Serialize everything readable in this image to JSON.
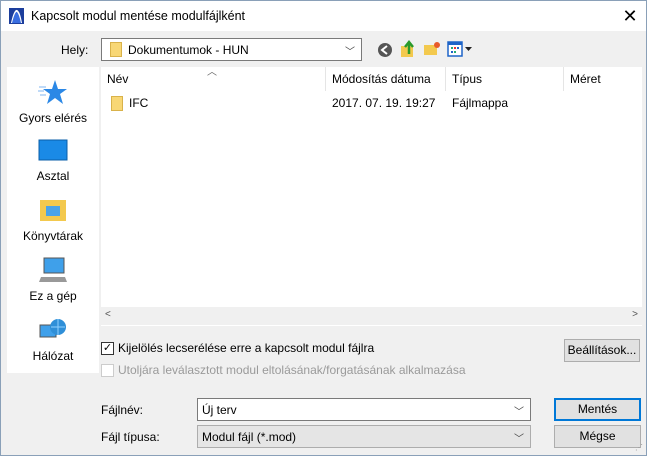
{
  "title": "Kapcsolt modul mentése modulfájlként",
  "location": {
    "label": "Hely:",
    "value": "Dokumentumok - HUN"
  },
  "sidebar": {
    "items": [
      {
        "label": "Gyors elérés"
      },
      {
        "label": "Asztal"
      },
      {
        "label": "Könyvtárak"
      },
      {
        "label": "Ez a gép"
      },
      {
        "label": "Hálózat"
      }
    ]
  },
  "list": {
    "columns": [
      "Név",
      "Módosítás dátuma",
      "Típus",
      "Méret"
    ],
    "rows": [
      {
        "name": "IFC",
        "date": "2017. 07. 19. 19:27",
        "type": "Fájlmappa",
        "size": ""
      }
    ]
  },
  "options": {
    "replace_label": "Kijelölés lecserélése erre a kapcsolt modul fájlra",
    "replace_checked": true,
    "apply_label": "Utoljára leválasztott modul eltolásának/forgatásának alkalmazása",
    "apply_checked": false,
    "settings_button": "Beállítások..."
  },
  "filename": {
    "label": "Fájlnév:",
    "value": "Új terv"
  },
  "filetype": {
    "label": "Fájl típusa:",
    "value": "Modul fájl (*.mod)"
  },
  "buttons": {
    "save": "Mentés",
    "cancel": "Mégse"
  }
}
